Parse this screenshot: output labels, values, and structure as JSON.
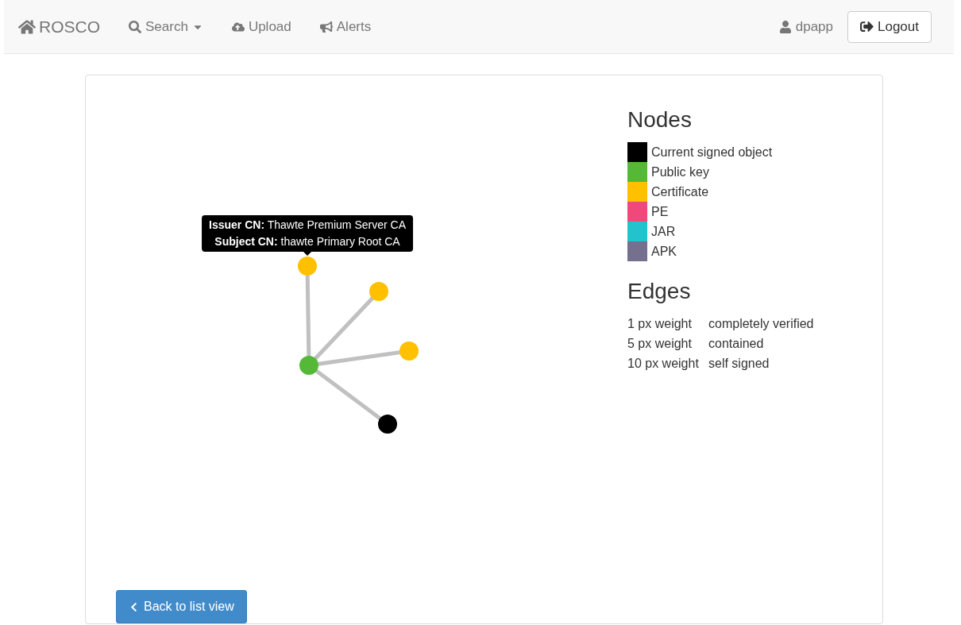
{
  "navbar": {
    "brand": "ROSCO",
    "links": [
      {
        "label": "Search",
        "dropdown": true
      },
      {
        "label": "Upload",
        "dropdown": false
      },
      {
        "label": "Alerts",
        "dropdown": false
      }
    ],
    "user": "dpapp",
    "logout": "Logout"
  },
  "graph": {
    "nodes": [
      {
        "color": "#ffc000"
      },
      {
        "color": "#ffc000"
      },
      {
        "color": "#ffc000"
      },
      {
        "color": "#55b837"
      },
      {
        "color": "#000000"
      }
    ],
    "tooltip": {
      "lines": [
        "**Issuer CN:** Thawte Premium Server CA",
        "**Subject CN:** thawte Primary Root CA"
      ]
    }
  },
  "legend": {
    "nodes_title": "Nodes",
    "nodes": [
      {
        "label": "Current signed object",
        "color": "#000000"
      },
      {
        "label": "Public key",
        "color": "#55b837"
      },
      {
        "label": "Certificate",
        "color": "#ffc000"
      },
      {
        "label": "PE",
        "color": "#f0487a"
      },
      {
        "label": "JAR",
        "color": "#22c3cc"
      },
      {
        "label": "APK",
        "color": "#76708f"
      }
    ],
    "edges_title": "Edges",
    "edges": [
      {
        "weight": "1 px weight",
        "meaning": "completely verified"
      },
      {
        "weight": "5 px weight",
        "meaning": "contained"
      },
      {
        "weight": "10 px weight",
        "meaning": "self signed"
      }
    ]
  },
  "back_button": "Back to list view"
}
